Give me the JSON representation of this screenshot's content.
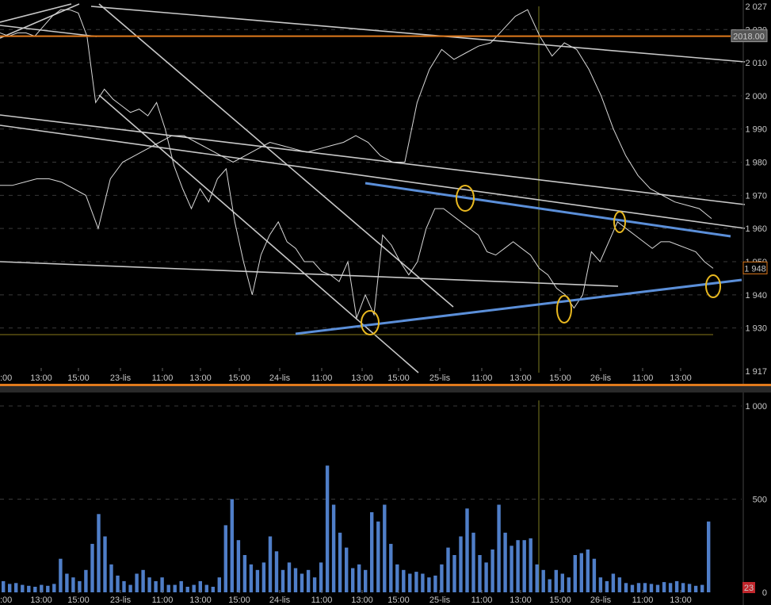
{
  "chart_data": [
    {
      "type": "line",
      "panel": "price",
      "ylim": [
        1917,
        2027
      ],
      "y_ticks": [
        "2 027",
        "2 020",
        "2 010",
        "2 000",
        "1 990",
        "1 980",
        "1 970",
        "1 960",
        "1 950",
        "1 940",
        "1 930",
        "1 917"
      ],
      "y_tick_values": [
        2027,
        2020,
        2010,
        2000,
        1990,
        1980,
        1970,
        1960,
        1950,
        1940,
        1930,
        1917
      ],
      "x_ticks": [
        ":00",
        "13:00",
        "15:00",
        "23-lis",
        "11:00",
        "13:00",
        "15:00",
        "24-lis",
        "11:00",
        "13:00",
        "15:00",
        "25-lis",
        "11:00",
        "13:00",
        "15:00",
        "26-lis",
        "11:00",
        "13:00"
      ],
      "last_price_label": "1 948",
      "last_price": 1948,
      "horizontal_level_label": "2018.00",
      "horizontal_level": 2018,
      "support_level": 1928,
      "accent_level_color": "#e07a1c",
      "channel_color": "#5b8fd9",
      "marker_color": "#e8b820",
      "series": [
        {
          "values": [
            2019,
            2018,
            2019,
            2019,
            2018,
            2021,
            2024,
            2026,
            2026,
            2025,
            2018,
            1998,
            2002,
            1999,
            1997,
            1995,
            1996,
            1994,
            1998,
            1990,
            1979,
            1972,
            1966,
            1972,
            1968,
            1975,
            1978,
            1962,
            1950,
            1940,
            1952,
            1958,
            1962,
            1956,
            1954,
            1950,
            1950,
            1947,
            1946,
            1944,
            1950,
            1933,
            1940,
            1934,
            1958,
            1955,
            1950,
            1946,
            1950,
            1960,
            1966,
            1966,
            1964,
            1962,
            1960,
            1958,
            1953,
            1952,
            1954,
            1956,
            1954,
            1952,
            1948,
            1946,
            1942,
            1940,
            1936,
            1940,
            1953,
            1950,
            1956,
            1962,
            1960,
            1958,
            1956,
            1954,
            1956,
            1956,
            1955,
            1954,
            1953,
            1950,
            1948
          ]
        },
        {
          "values": [
            1973,
            1973,
            1974,
            1975,
            1975,
            1974,
            1972,
            1970,
            1960,
            1975,
            1980,
            1982,
            1984,
            1986,
            1988,
            1988,
            1986,
            1984,
            1982,
            1980,
            1982,
            1984,
            1986,
            1985,
            1984,
            1983,
            1984,
            1985,
            1986,
            1988,
            1986,
            1982,
            1980,
            1980,
            1998,
            2008,
            2014,
            2011,
            2013,
            2015,
            2016,
            2020,
            2024,
            2026,
            2018,
            2012,
            2016,
            2014,
            2008,
            2000,
            1990,
            1982,
            1976,
            1972,
            1970,
            1968,
            1967,
            1966,
            1963
          ]
        }
      ]
    },
    {
      "type": "bar",
      "panel": "volume",
      "ylim": [
        0,
        1000
      ],
      "y_ticks": [
        "1 000",
        "500",
        "0"
      ],
      "y_tick_values": [
        1000,
        500,
        0
      ],
      "x_ticks": [
        ":00",
        "13:00",
        "15:00",
        "23-lis",
        "11:00",
        "13:00",
        "15:00",
        "24-lis",
        "11:00",
        "13:00",
        "15:00",
        "25-lis",
        "11:00",
        "13:00",
        "15:00",
        "26-lis",
        "11:00",
        "13:00"
      ],
      "last_value_label": "23",
      "last_value": 23,
      "bar_color": "#4f7ec8",
      "values": [
        60,
        45,
        50,
        40,
        35,
        30,
        40,
        35,
        45,
        180,
        100,
        80,
        60,
        120,
        260,
        420,
        300,
        150,
        90,
        60,
        40,
        100,
        120,
        80,
        60,
        80,
        40,
        40,
        60,
        30,
        40,
        60,
        40,
        30,
        80,
        360,
        500,
        280,
        200,
        150,
        120,
        160,
        300,
        220,
        120,
        160,
        130,
        100,
        120,
        80,
        160,
        680,
        470,
        320,
        240,
        130,
        150,
        120,
        430,
        380,
        470,
        260,
        150,
        120,
        100,
        110,
        100,
        80,
        90,
        150,
        240,
        200,
        300,
        450,
        320,
        200,
        160,
        230,
        470,
        320,
        250,
        280,
        280,
        290,
        150,
        120,
        70,
        120,
        100,
        80,
        200,
        210,
        230,
        180,
        80,
        60,
        100,
        80,
        50,
        40,
        50,
        50,
        45,
        40,
        55,
        50,
        60,
        50,
        45,
        35,
        40,
        380
      ]
    }
  ]
}
